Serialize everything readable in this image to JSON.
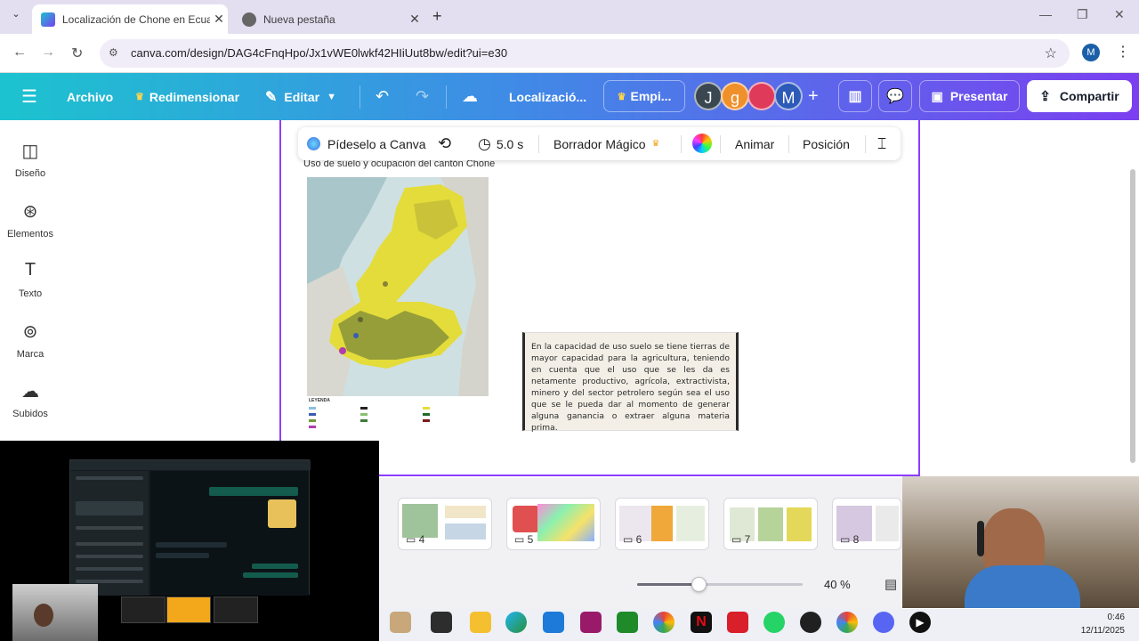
{
  "browser": {
    "tabs": [
      {
        "title": "Localización de Chone en Ecuad",
        "active": true
      },
      {
        "title": "Nueva pestaña",
        "active": false
      }
    ],
    "url": "canva.com/design/DAG4cFnqHpo/Jx1vWE0lwkf42HIiUut8bw/edit?ui=e30",
    "profile_initial": "M"
  },
  "canva_header": {
    "menu_icon": "hamburger-icon",
    "archivo": "Archivo",
    "redimensionar": "Redimensionar",
    "editar": "Editar",
    "title": "Localizació...",
    "empi": "Empi...",
    "avatars": [
      {
        "letter": "J",
        "color": "#3a4750"
      },
      {
        "letter": "g",
        "color": "#f0902b"
      },
      {
        "letter": "",
        "color": "#e03a5a"
      },
      {
        "letter": "M",
        "color": "#2d5ab8"
      }
    ],
    "presentar": "Presentar",
    "compartir": "Compartir"
  },
  "sidebar": {
    "items": [
      {
        "label": "Diseño",
        "icon": "layout-icon"
      },
      {
        "label": "Elementos",
        "icon": "shapes-icon"
      },
      {
        "label": "Texto",
        "icon": "text-icon"
      },
      {
        "label": "Marca",
        "icon": "brand-icon"
      },
      {
        "label": "Subidos",
        "icon": "cloud-upload-icon"
      }
    ]
  },
  "context_toolbar": {
    "ask": "Pídeselo a Canva",
    "duration": "5.0 s",
    "magic_eraser": "Borrador Mágico",
    "animate": "Animar",
    "position": "Posición"
  },
  "design": {
    "map_caption": "Uso de suelo y ocupación del cantón Chone",
    "legend_title": "LEYENDA",
    "body_text": "En la capacidad de uso suelo se tiene tierras de mayor capacidad para la agricultura, teniendo en cuenta que el uso que se les da es netamente productivo, agrícola, extractivista, minero y del sector petrolero según sea el uso que se le pueda dar al momento de generar alguna ganancia o extraer alguna materia prima."
  },
  "pages": {
    "thumbs": [
      "4",
      "5",
      "6",
      "7",
      "8"
    ],
    "zoom": "40 %",
    "zoom_value": 0.37
  },
  "system": {
    "time": "0:46",
    "date": "12/11/2025"
  },
  "colors": {
    "accent": "#8b3dff",
    "header_start": "#1cc3cf",
    "header_end": "#7b3ff0"
  }
}
